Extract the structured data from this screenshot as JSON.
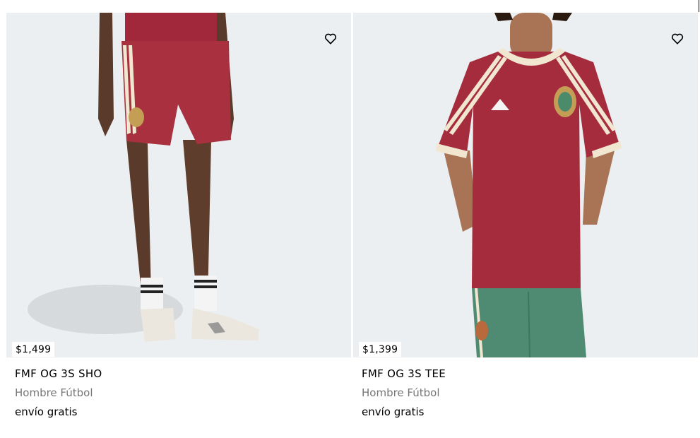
{
  "products": [
    {
      "name": "FMF OG 3S SHO",
      "price": "$1,499",
      "category": "Hombre Fútbol",
      "shipping": "envío gratis",
      "wishlist_icon": "heart-outline-icon"
    },
    {
      "name": "FMF OG 3S TEE",
      "price": "$1,399",
      "category": "Hombre Fútbol",
      "shipping": "envío gratis",
      "wishlist_icon": "heart-outline-icon"
    }
  ],
  "colors": {
    "image_bg": "#eceff1",
    "kit_red": "#a0283a",
    "stripe_cream": "#f1e6cf",
    "pants_green": "#4f8b72",
    "muted_text": "#767677"
  }
}
